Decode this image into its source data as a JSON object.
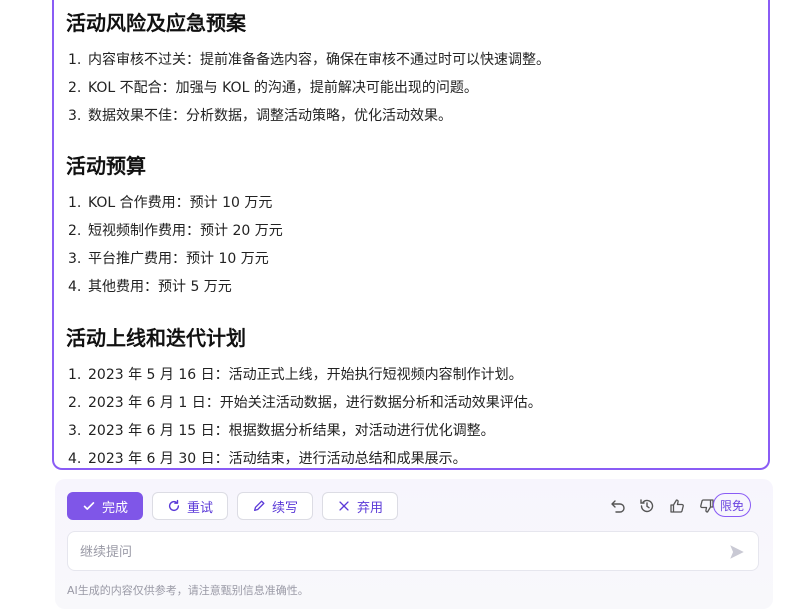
{
  "sections": [
    {
      "title": "活动风险及应急预案",
      "items": [
        {
          "num": "1.",
          "text": "内容审核不过关：提前准备备选内容，确保在审核不通过时可以快速调整。"
        },
        {
          "num": "2.",
          "text": "KOL 不配合：加强与 KOL 的沟通，提前解决可能出现的问题。"
        },
        {
          "num": "3.",
          "text": "数据效果不佳：分析数据，调整活动策略，优化活动效果。"
        }
      ]
    },
    {
      "title": "活动预算",
      "items": [
        {
          "num": "1.",
          "text": "KOL 合作费用：预计 10 万元"
        },
        {
          "num": "2.",
          "text": "短视频制作费用：预计 20 万元"
        },
        {
          "num": "3.",
          "text": "平台推广费用：预计 10 万元"
        },
        {
          "num": "4.",
          "text": "其他费用：预计 5 万元"
        }
      ]
    },
    {
      "title": "活动上线和迭代计划",
      "items": [
        {
          "num": "1.",
          "text": "2023 年 5 月 16 日：活动正式上线，开始执行短视频内容制作计划。"
        },
        {
          "num": "2.",
          "text": "2023 年 6 月 1 日：开始关注活动数据，进行数据分析和活动效果评估。"
        },
        {
          "num": "3.",
          "text": "2023 年 6 月 15 日：根据数据分析结果，对活动进行优化调整。"
        },
        {
          "num": "4.",
          "text": "2023 年 6 月 30 日：活动结束，进行活动总结和成果展示。"
        }
      ]
    }
  ],
  "toolbar": {
    "done_label": "完成",
    "retry_label": "重试",
    "continue_label": "续写",
    "discard_label": "弃用",
    "badge_label": "限免"
  },
  "input": {
    "placeholder": "继续提问",
    "value": ""
  },
  "disclaimer": "AI生成的内容仅供参考，请注意甄别信息准确性。",
  "colors": {
    "accent": "#7f56e8",
    "border_accent": "#8a5cf5"
  },
  "icons": {
    "done": "check-icon",
    "retry": "refresh-icon",
    "continue": "pen-icon",
    "discard": "close-icon",
    "undo": "undo-icon",
    "history": "history-icon",
    "like": "thumbs-up-icon",
    "dislike": "thumbs-down-icon",
    "send": "send-icon"
  }
}
